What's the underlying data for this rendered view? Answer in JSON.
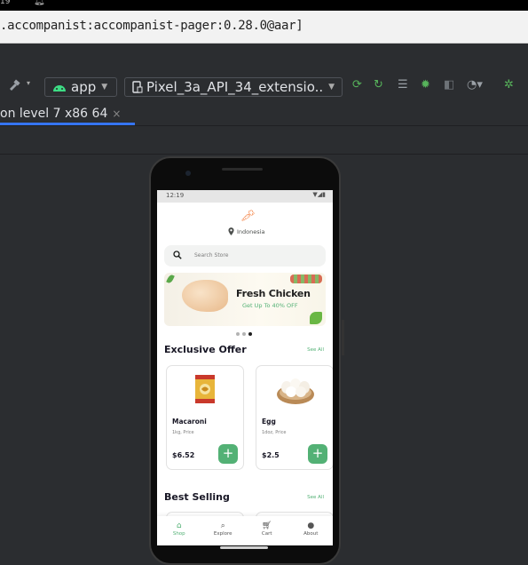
{
  "system_bar": {
    "time_fragment": "19"
  },
  "dependency_bar": {
    "text": ".accompanist:accompanist-pager:0.28.0@aar]"
  },
  "toolbar": {
    "config_label": "app",
    "device_label": "Pixel_3a_API_34_extensio..",
    "icons": [
      "hammer-icon",
      "android-icon",
      "device-icon",
      "rerun-icon",
      "apply-changes-icon",
      "log-icon",
      "debug-bug-icon",
      "attach-icon",
      "profiler-icon",
      "app-inspection-icon"
    ]
  },
  "tab": {
    "label": "on level 7 x86 64",
    "close_glyph": "×"
  },
  "colors": {
    "accent_green": "#53b175",
    "tab_underline": "#3574f0",
    "carrot": "#f3722c"
  },
  "app": {
    "status_time": "12:19",
    "location": "Indonesia",
    "search_placeholder": "Search Store",
    "banner": {
      "title": "Fresh Chicken",
      "subtitle": "Get Up To 40% OFF"
    },
    "exclusive": {
      "title": "Exclusive Offer",
      "see_all": "See All",
      "products": [
        {
          "name": "Macaroni",
          "qty": "1kg, Price",
          "price": "$6.52"
        },
        {
          "name": "Egg",
          "qty": "1doz, Price",
          "price": "$2.5"
        }
      ]
    },
    "best_selling": {
      "title": "Best Selling",
      "see_all": "See All"
    },
    "nav": [
      {
        "label": "Shop",
        "icon": "store-icon"
      },
      {
        "label": "Explore",
        "icon": "explore-icon"
      },
      {
        "label": "Cart",
        "icon": "cart-icon"
      },
      {
        "label": "About",
        "icon": "profile-icon"
      }
    ]
  }
}
